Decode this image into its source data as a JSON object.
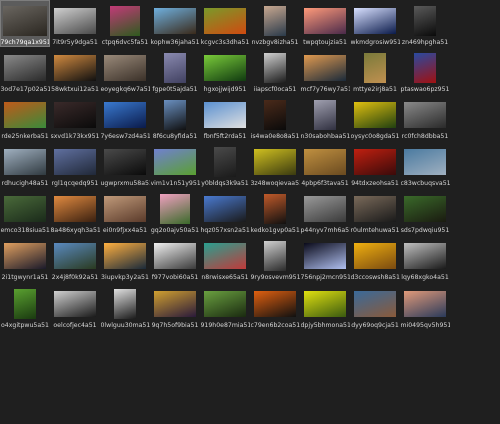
{
  "window": {
    "background": "#1f1f1f",
    "selected_tile": "79ch79qa1x951"
  },
  "files": [
    {
      "name": "79ch79qa1x951",
      "shape": "l",
      "colors": [
        "#6a6660",
        "#2a2620"
      ],
      "selected": true
    },
    {
      "name": "7it9r5y9dga51",
      "shape": "w",
      "colors": [
        "#cfcfcf",
        "#4a4a4a"
      ]
    },
    {
      "name": "ctpq6dvc5fa51",
      "shape": "s",
      "colors": [
        "#c23a78",
        "#2e5a1e"
      ]
    },
    {
      "name": "kophw36jaha51",
      "shape": "w",
      "colors": [
        "#6fb0de",
        "#3a2a1a"
      ]
    },
    {
      "name": "kcgvc3s3dha51",
      "shape": "w",
      "colors": [
        "#7a9a2a",
        "#d04a10"
      ]
    },
    {
      "name": "nvzbgv8izha51",
      "shape": "p",
      "colors": [
        "#c8a890",
        "#2a3a4a"
      ]
    },
    {
      "name": "twpqtoujzia51",
      "shape": "w",
      "colors": [
        "#ff9a7a",
        "#4a2a4a"
      ]
    },
    {
      "name": "wkmdgrosiw951",
      "shape": "w",
      "colors": [
        "#d8e0ff",
        "#0a1a4a"
      ]
    },
    {
      "name": "zn469hpgha51",
      "shape": "p",
      "colors": [
        "#5a5a5a",
        "#0a0a0a"
      ]
    },
    {
      "name": "",
      "shape": "none",
      "colors": [
        "#1f1f1f",
        "#1f1f1f"
      ]
    },
    {
      "name": "3od7e17p02a51",
      "shape": "w",
      "colors": [
        "#8a8a8a",
        "#2a2a2a"
      ]
    },
    {
      "name": "58wktxui12a51",
      "shape": "w",
      "colors": [
        "#d08a40",
        "#101010"
      ]
    },
    {
      "name": "eoyegkq6w7a51",
      "shape": "w",
      "colors": [
        "#9a8a7a",
        "#3a3028"
      ]
    },
    {
      "name": "fgpe0t5ajda51",
      "shape": "p",
      "colors": [
        "#8a8ab0",
        "#404060"
      ]
    },
    {
      "name": "hgxojjwijd951",
      "shape": "w",
      "colors": [
        "#7acb3a",
        "#103a10"
      ]
    },
    {
      "name": "iiapscf0oca51",
      "shape": "p",
      "colors": [
        "#d0d0d0",
        "#1a1a1a"
      ]
    },
    {
      "name": "mcf7y76wy7a51",
      "shape": "w",
      "colors": [
        "#e09a50",
        "#1a2a3a"
      ]
    },
    {
      "name": "mttye2irj8a51",
      "shape": "p",
      "colors": [
        "#7a7a3a",
        "#c09050"
      ]
    },
    {
      "name": "ptaswao6pz951",
      "shape": "p",
      "colors": [
        "#2a4aa0",
        "#a01010"
      ]
    },
    {
      "name": "",
      "shape": "none",
      "colors": [
        "#1f1f1f",
        "#1f1f1f"
      ]
    },
    {
      "name": "rde25nkerba51",
      "shape": "w",
      "colors": [
        "#c05a1a",
        "#3a8a3a"
      ]
    },
    {
      "name": "sxvd1k73kx951",
      "shape": "w",
      "colors": [
        "#3a2a2a",
        "#0a0a0a"
      ]
    },
    {
      "name": "7y6esw7zd4a51",
      "shape": "w",
      "colors": [
        "#3a7ad0",
        "#0a1a4a"
      ]
    },
    {
      "name": "8f6cu8yfida51",
      "shape": "p",
      "colors": [
        "#6a90c0",
        "#101010"
      ]
    },
    {
      "name": "fbnf5ft2rda51",
      "shape": "w",
      "colors": [
        "#5a90d0",
        "#e0e0e0"
      ]
    },
    {
      "name": "is4wa0e8o8a51",
      "shape": "p",
      "colors": [
        "#4a2a1a",
        "#0a0a0a"
      ]
    },
    {
      "name": "n30sabohbaa51",
      "shape": "p",
      "colors": [
        "#a0a0b0",
        "#303040"
      ]
    },
    {
      "name": "oysyc0o8gda51",
      "shape": "w",
      "colors": [
        "#e0c010",
        "#204010"
      ]
    },
    {
      "name": "rc0fch8dbba51",
      "shape": "w",
      "colors": [
        "#8a8a8a",
        "#2a2a2a"
      ]
    },
    {
      "name": "",
      "shape": "none",
      "colors": [
        "#1f1f1f",
        "#1f1f1f"
      ]
    },
    {
      "name": "rdhucigh48a51",
      "shape": "w",
      "colors": [
        "#a0b0c0",
        "#303a40"
      ]
    },
    {
      "name": "rgl1qcqedq951",
      "shape": "w",
      "colors": [
        "#6070a0",
        "#202838"
      ]
    },
    {
      "name": "ugwprxmu58a51",
      "shape": "w",
      "colors": [
        "#4a4a4a",
        "#0a0a0a"
      ]
    },
    {
      "name": "vim1v1n51y951",
      "shape": "w",
      "colors": [
        "#7080d0",
        "#5aa030"
      ]
    },
    {
      "name": "y0bldqs3k9a51",
      "shape": "p",
      "colors": [
        "#4a4a4a",
        "#1a1a1a"
      ]
    },
    {
      "name": "3z48woqievaa51",
      "shape": "w",
      "colors": [
        "#d0c020",
        "#3a3a10"
      ]
    },
    {
      "name": "4pbp6f3tava51",
      "shape": "w",
      "colors": [
        "#c09040",
        "#6a4a20"
      ]
    },
    {
      "name": "94tdxzeohsa51",
      "shape": "w",
      "colors": [
        "#c02010",
        "#3a0a0a"
      ]
    },
    {
      "name": "c83wcbuqsva51",
      "shape": "w",
      "colors": [
        "#4a7aa0",
        "#a0b0c0"
      ]
    },
    {
      "name": "",
      "shape": "none",
      "colors": [
        "#1f1f1f",
        "#1f1f1f"
      ]
    },
    {
      "name": "emco318siua51",
      "shape": "w",
      "colors": [
        "#4a6a3a",
        "#1a2a1a"
      ]
    },
    {
      "name": "8a486xyqh3a51",
      "shape": "w",
      "colors": [
        "#e08a40",
        "#3a2010"
      ]
    },
    {
      "name": "ei0n9fjxx4a51",
      "shape": "w",
      "colors": [
        "#c09a7a",
        "#5a3a2a"
      ]
    },
    {
      "name": "gq2o0ajv50a51",
      "shape": "s",
      "colors": [
        "#f0a0c0",
        "#3a6a2a"
      ]
    },
    {
      "name": "hqz057xsn2a51",
      "shape": "w",
      "colors": [
        "#4a7ad0",
        "#1a1a1a"
      ]
    },
    {
      "name": "kedko1gvp0a51",
      "shape": "p",
      "colors": [
        "#c05a2a",
        "#101010"
      ]
    },
    {
      "name": "p44nyv7mh6a51",
      "shape": "w",
      "colors": [
        "#9a9a9a",
        "#3a3a3a"
      ]
    },
    {
      "name": "r0ulmtehuwa51",
      "shape": "w",
      "colors": [
        "#7a6a5a",
        "#1a1a1a"
      ]
    },
    {
      "name": "sds7pdwqiu951",
      "shape": "w",
      "colors": [
        "#3a6a2a",
        "#1a1a10"
      ]
    },
    {
      "name": "",
      "shape": "none",
      "colors": [
        "#1f1f1f",
        "#1f1f1f"
      ]
    },
    {
      "name": "2i1tgwynr1a51",
      "shape": "w",
      "colors": [
        "#e0a060",
        "#1a1a2a"
      ]
    },
    {
      "name": "2x4j8f0k92a51",
      "shape": "w",
      "colors": [
        "#5a8ac0",
        "#2a3a20"
      ]
    },
    {
      "name": "3iupvkp3y2a51",
      "shape": "w",
      "colors": [
        "#ffb040",
        "#1a2a3a"
      ]
    },
    {
      "name": "f977vobi60a51",
      "shape": "w",
      "colors": [
        "#f0f0f0",
        "#3a3a3a"
      ]
    },
    {
      "name": "n8rwisxe65a51",
      "shape": "w",
      "colors": [
        "#2aa090",
        "#c03a3a"
      ]
    },
    {
      "name": "9ry9osvevm951",
      "shape": "p",
      "colors": [
        "#d0d0d0",
        "#2a2a2a"
      ]
    },
    {
      "name": "756npj2mcn951",
      "shape": "w",
      "colors": [
        "#0a0a1a",
        "#b0c0f0"
      ]
    },
    {
      "name": "d3ccoswsh8a51",
      "shape": "w",
      "colors": [
        "#f0b010",
        "#7a4a10"
      ]
    },
    {
      "name": "lqy68xgko4a51",
      "shape": "w",
      "colors": [
        "#c0c0c0",
        "#1a1a1a"
      ]
    },
    {
      "name": "",
      "shape": "none",
      "colors": [
        "#1f1f1f",
        "#1f1f1f"
      ]
    },
    {
      "name": "o4xgitpwu5a51",
      "shape": "p",
      "colors": [
        "#5aa030",
        "#1a3a10"
      ]
    },
    {
      "name": "oelcofjec4a51",
      "shape": "w",
      "colors": [
        "#d0d0d0",
        "#1a1a1a"
      ]
    },
    {
      "name": "0lwlguu30ma51",
      "shape": "p",
      "colors": [
        "#e0e0e0",
        "#1a1a1a"
      ]
    },
    {
      "name": "9q7h5of9bia51",
      "shape": "w",
      "colors": [
        "#d0a030",
        "#2a1a3a"
      ]
    },
    {
      "name": "919h0e87mia51",
      "shape": "w",
      "colors": [
        "#6aa040",
        "#1a2a10"
      ]
    },
    {
      "name": "c79en6b2coa51",
      "shape": "w",
      "colors": [
        "#e06010",
        "#101010"
      ]
    },
    {
      "name": "dpjy5bhmona51",
      "shape": "w",
      "colors": [
        "#e0e010",
        "#3a5a10"
      ]
    },
    {
      "name": "dyy69oq9cja51",
      "shape": "w",
      "colors": [
        "#3a6a9a",
        "#8a5a3a"
      ]
    },
    {
      "name": "mi0495qv5h951",
      "shape": "w",
      "colors": [
        "#e09a7a",
        "#2a3a5a"
      ]
    },
    {
      "name": "",
      "shape": "none",
      "colors": [
        "#1f1f1f",
        "#1f1f1f"
      ]
    },
    {
      "name": "",
      "shape": "none",
      "colors": [
        "#1f1f1f",
        "#1f1f1f"
      ]
    },
    {
      "name": "",
      "shape": "none",
      "colors": [
        "#1f1f1f",
        "#1f1f1f"
      ]
    },
    {
      "name": "",
      "shape": "none",
      "colors": [
        "#1f1f1f",
        "#1f1f1f"
      ]
    },
    {
      "name": "",
      "shape": "none",
      "colors": [
        "#1f1f1f",
        "#1f1f1f"
      ]
    },
    {
      "name": "",
      "shape": "none",
      "colors": [
        "#1f1f1f",
        "#1f1f1f"
      ]
    },
    {
      "name": "",
      "shape": "none",
      "colors": [
        "#1f1f1f",
        "#1f1f1f"
      ]
    },
    {
      "name": "",
      "shape": "none",
      "colors": [
        "#1f1f1f",
        "#1f1f1f"
      ]
    },
    {
      "name": "",
      "shape": "none",
      "colors": [
        "#1f1f1f",
        "#1f1f1f"
      ]
    },
    {
      "name": "",
      "shape": "none",
      "colors": [
        "#1f1f1f",
        "#1f1f1f"
      ]
    },
    {
      "name": "",
      "shape": "none",
      "colors": [
        "#1f1f1f",
        "#1f1f1f"
      ]
    }
  ]
}
